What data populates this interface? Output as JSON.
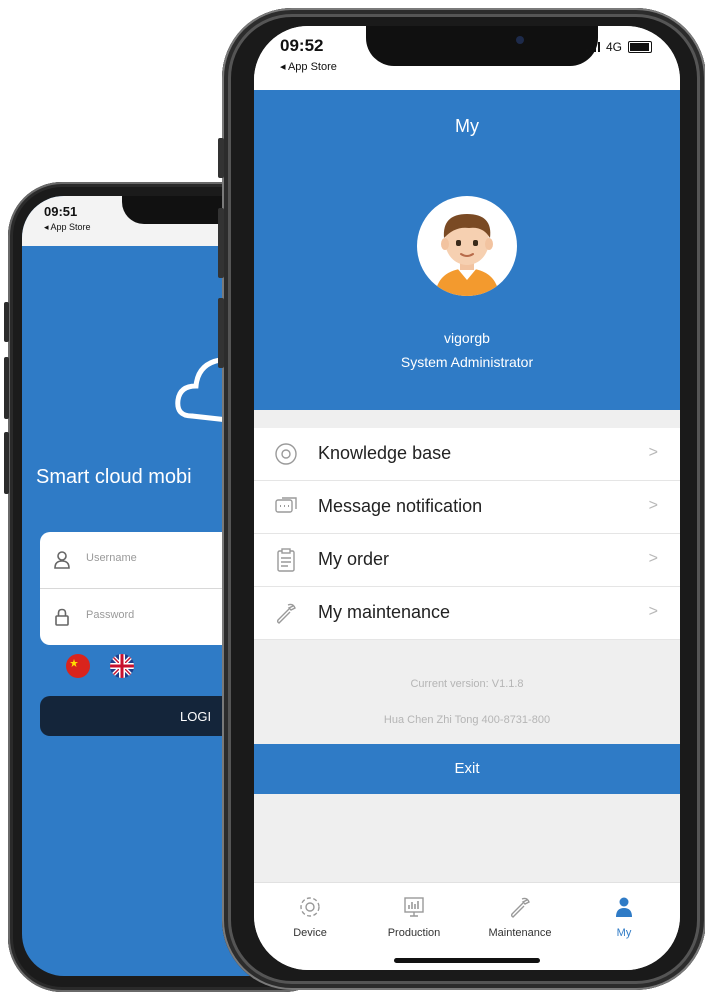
{
  "colors": {
    "primary": "#2f7bc6",
    "login_button": "#14253a"
  },
  "back_phone": {
    "status": {
      "time": "09:51",
      "back_label": "◂ App Store"
    },
    "title": "Smart cloud mobi",
    "username_placeholder": "Username",
    "password_placeholder": "Password",
    "login_label": "LOGI",
    "icons": [
      "cloud-logo-icon",
      "user-icon",
      "lock-icon",
      "flag-china-icon",
      "flag-uk-icon"
    ]
  },
  "front_phone": {
    "status": {
      "time": "09:52",
      "back_label": "◂ App Store",
      "network": "4G"
    },
    "header": {
      "title": "My",
      "user_name": "vigorgb",
      "user_role": "System Administrator"
    },
    "menu": [
      {
        "label": "Knowledge base",
        "icon": "knowledge-base-icon"
      },
      {
        "label": "Message notification",
        "icon": "message-icon"
      },
      {
        "label": "My order",
        "icon": "clipboard-icon"
      },
      {
        "label": "My maintenance",
        "icon": "wrench-icon"
      }
    ],
    "version": "Current version: V1.1.8",
    "contact": "Hua Chen Zhi Tong 400-8731-800",
    "exit_label": "Exit",
    "tabs": [
      {
        "label": "Device",
        "icon": "gear-icon",
        "active": false
      },
      {
        "label": "Production",
        "icon": "chart-icon",
        "active": false
      },
      {
        "label": "Maintenance",
        "icon": "wrench-icon",
        "active": false
      },
      {
        "label": "My",
        "icon": "person-icon",
        "active": true
      }
    ]
  }
}
